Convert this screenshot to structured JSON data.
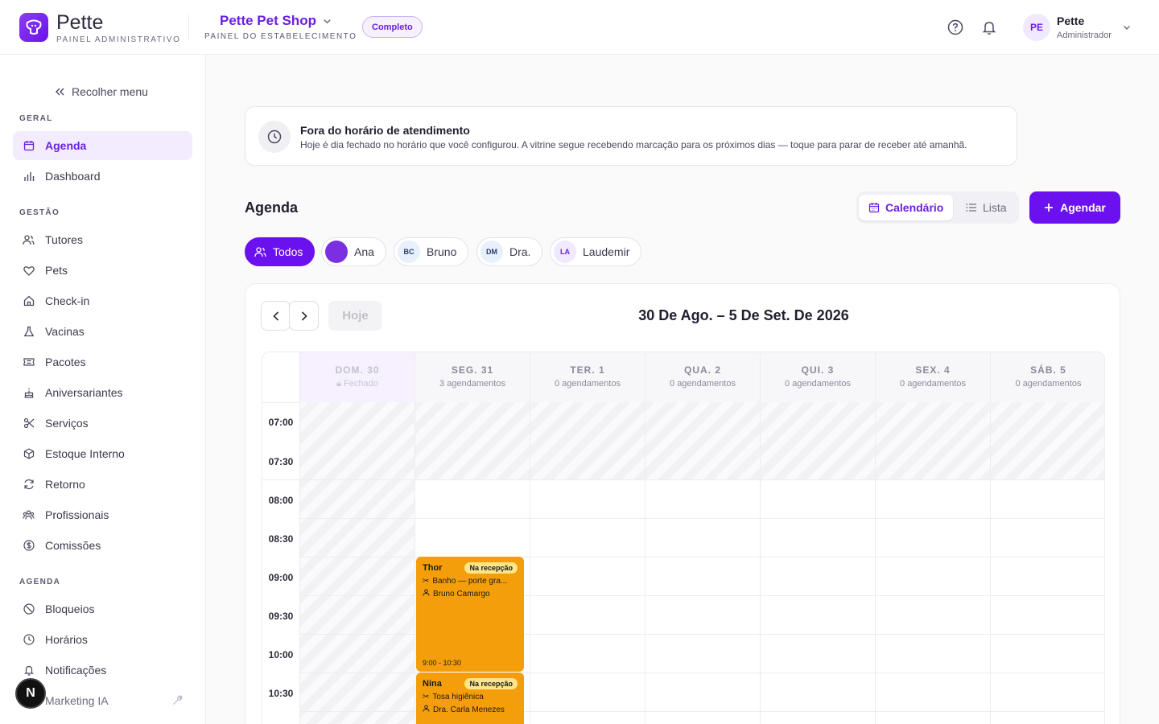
{
  "brand": {
    "name": "Pette",
    "subtitle": "PAINEL ADMINISTRATIVO",
    "accent": "#6b10ef"
  },
  "shop": {
    "name": "Pette Pet Shop",
    "subtitle": "PAINEL DO ESTABELECIMENTO",
    "plan": "Completo"
  },
  "user": {
    "initials": "PE",
    "name": "Pette",
    "role": "Administrador"
  },
  "sidebar": {
    "collapse_label": "Recolher menu",
    "sections": [
      {
        "title": "GERAL",
        "items": [
          "Agenda",
          "Dashboard"
        ]
      },
      {
        "title": "GESTÃO",
        "items": [
          "Tutores",
          "Pets",
          "Check-in",
          "Vacinas",
          "Pacotes",
          "Aniversariantes",
          "Serviços",
          "Estoque Interno",
          "Retorno",
          "Profissionais",
          "Comissões"
        ]
      },
      {
        "title": "AGENDA",
        "items": [
          "Bloqueios",
          "Horários",
          "Notificações",
          "Marketing IA"
        ]
      }
    ],
    "active_item": "Agenda"
  },
  "notice": {
    "title": "Fora do horário de atendimento",
    "text": "Hoje é dia fechado no horário que você configurou. A vitrine segue recebendo marcação para os próximos dias — toque para parar de receber até amanhã."
  },
  "page": {
    "title": "Agenda",
    "view_calendar": "Calendário",
    "view_list": "Lista",
    "new_button": "Agendar"
  },
  "filters": [
    {
      "label": "Todos",
      "initials": ""
    },
    {
      "label": "Ana",
      "initials": ""
    },
    {
      "label": "Bruno",
      "initials": "BC"
    },
    {
      "label": "Dra.",
      "initials": "DM"
    },
    {
      "label": "Laudemir",
      "initials": "LA"
    }
  ],
  "calendar": {
    "range_label": "30 De Ago. – 5 De Set. De 2026",
    "today_label": "Hoje",
    "days": [
      {
        "name": "DOM. 30",
        "sub": "Fechado",
        "closed": true
      },
      {
        "name": "SEG. 31",
        "sub": "3 agendamentos"
      },
      {
        "name": "TER. 1",
        "sub": "0 agendamentos"
      },
      {
        "name": "QUA. 2",
        "sub": "0 agendamentos"
      },
      {
        "name": "QUI. 3",
        "sub": "0 agendamentos"
      },
      {
        "name": "SEX. 4",
        "sub": "0 agendamentos"
      },
      {
        "name": "SÁB. 5",
        "sub": "0 agendamentos"
      }
    ],
    "times": [
      "07:00",
      "07:30",
      "08:00",
      "08:30",
      "09:00",
      "09:30",
      "10:00",
      "10:30"
    ],
    "appointments": [
      {
        "pet": "Thor",
        "status": "Na recepção",
        "service": "Banho — porte gra...",
        "professional": "Bruno Camargo",
        "time": "9:00 - 10:30",
        "color": "#f59e0b"
      },
      {
        "pet": "Nina",
        "status": "Na recepção",
        "service": "Tosa higiênica",
        "professional": "Dra. Carla Menezes",
        "time": "",
        "color": "#f59e0b"
      }
    ]
  }
}
